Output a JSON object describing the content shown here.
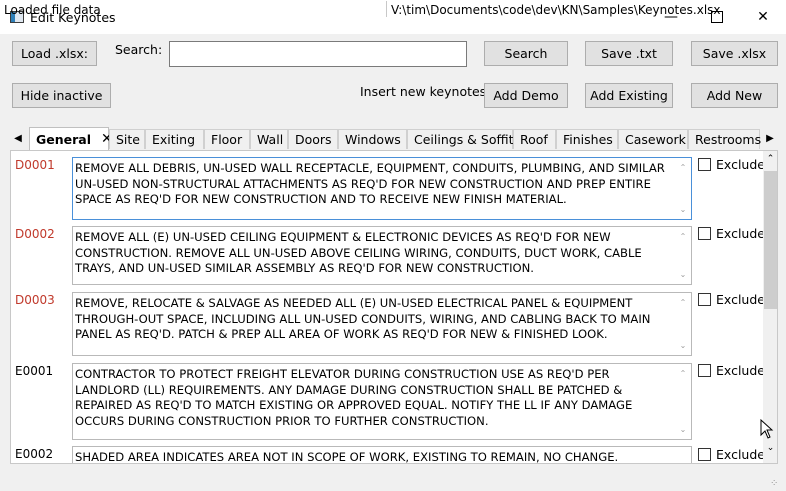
{
  "window": {
    "title": "Edit Keynotes"
  },
  "toolbar": {
    "load_xlsx": "Load .xlsx:",
    "search_label": "Search:",
    "search_value": "",
    "search_button": "Search",
    "save_txt": "Save .txt",
    "save_xlsx": "Save .xlsx",
    "hide_inactive": "Hide inactive",
    "insert_label": "Insert new keynotes:",
    "add_demo": "Add Demo",
    "add_existing": "Add Existing",
    "add_new": "Add New"
  },
  "tabs": [
    {
      "label": "General",
      "active": true
    },
    {
      "label": "Site"
    },
    {
      "label": "Exiting"
    },
    {
      "label": "Floor"
    },
    {
      "label": "Wall"
    },
    {
      "label": "Doors"
    },
    {
      "label": "Windows"
    },
    {
      "label": "Ceilings & Soffits"
    },
    {
      "label": "Roof"
    },
    {
      "label": "Finishes"
    },
    {
      "label": "Casework"
    },
    {
      "label": "Restrooms"
    }
  ],
  "keynotes": [
    {
      "code": "D0001",
      "status": "inactive",
      "text": "REMOVE ALL DEBRIS, UN-USED WALL RECEPTACLE, EQUIPMENT, CONDUITS, PLUMBING, AND SIMILAR UN-USED NON-STRUCTURAL ATTACHMENTS AS REQ'D FOR NEW CONSTRUCTION AND PREP ENTIRE SPACE AS REQ'D FOR NEW CONSTRUCTION AND TO RECEIVE NEW FINISH MATERIAL.",
      "exclude_label": "Exclude"
    },
    {
      "code": "D0002",
      "status": "inactive",
      "text": "REMOVE ALL (E) UN-USED CEILING EQUIPMENT & ELECTRONIC DEVICES AS REQ'D FOR NEW CONSTRUCTION. REMOVE ALL UN-USED ABOVE CEILING WIRING, CONDUITS, DUCT WORK, CABLE TRAYS, AND UN-USED SIMILAR ASSEMBLY AS REQ'D FOR NEW CONSTRUCTION.",
      "exclude_label": "Exclude"
    },
    {
      "code": "D0003",
      "status": "inactive",
      "text": "REMOVE, RELOCATE & SALVAGE AS NEEDED ALL (E) UN-USED ELECTRICAL PANEL & EQUIPMENT THROUGH-OUT SPACE, INCLUDING ALL UN-USED CONDUITS, WIRING, AND CABLING BACK TO MAIN PANEL AS REQ'D. PATCH & PREP ALL AREA OF WORK AS REQ'D FOR NEW & FINISHED LOOK.",
      "exclude_label": "Exclude"
    },
    {
      "code": "E0001",
      "status": "active",
      "text": "CONTRACTOR TO PROTECT FREIGHT ELEVATOR DURING CONSTRUCTION USE AS REQ'D PER LANDLORD (LL) REQUIREMENTS. ANY DAMAGE DURING CONSTRUCTION SHALL BE PATCHED & REPAIRED AS REQ'D TO MATCH EXISTING OR APPROVED EQUAL. NOTIFY THE LL IF ANY DAMAGE OCCURS DURING CONSTRUCTION PRIOR TO FURTHER CONSTRUCTION.",
      "exclude_label": "Exclude"
    },
    {
      "code": "E0002",
      "status": "active",
      "text": "SHADED AREA INDICATES AREA NOT IN SCOPE OF WORK, EXISTING TO REMAIN, NO CHANGE.",
      "exclude_label": "Exclude"
    }
  ],
  "status": {
    "left": "Loaded file data",
    "right": "V:\\tim\\Documents\\code\\dev\\KN\\Samples\\Keynotes.xlsx"
  },
  "colors": {
    "inactive_code": "#c0392b",
    "focus_border": "#4a90d9"
  }
}
